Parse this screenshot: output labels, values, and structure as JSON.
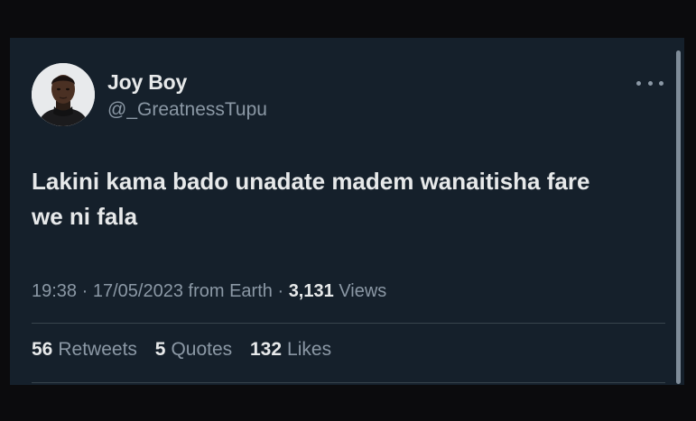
{
  "tweet": {
    "author": {
      "name": "Joy Boy",
      "handle": "@_GreatnessTupu",
      "avatar_icon": "profile-photo"
    },
    "text_line1": "Lakini kama bado unadate madem wanaitisha fare",
    "text_line2": "we ni fala",
    "time": "19:38",
    "date": "17/05/2023",
    "source": "from Earth",
    "separator": "·",
    "views_count": "3,131",
    "views_label": "Views",
    "retweets_count": "56",
    "retweets_label": "Retweets",
    "quotes_count": "5",
    "quotes_label": "Quotes",
    "likes_count": "132",
    "likes_label": "Likes"
  },
  "colors": {
    "background": "#15202b",
    "primary_text": "#e7e9ea",
    "secondary_text": "#8b98a5",
    "divider": "#38444d"
  }
}
